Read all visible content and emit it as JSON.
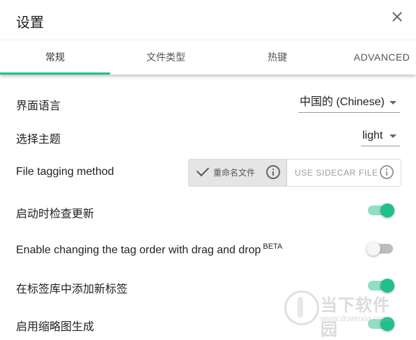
{
  "dialog": {
    "title": "设置"
  },
  "tabs": [
    {
      "label": "常规"
    },
    {
      "label": "文件类型"
    },
    {
      "label": "热键"
    },
    {
      "label": "ADVANCED"
    }
  ],
  "settings": {
    "language": {
      "label": "界面语言",
      "value": "中国的 (Chinese)"
    },
    "theme": {
      "label": "选择主题",
      "value": "light"
    },
    "tagging": {
      "label": "File tagging method",
      "option_rename": "重命名文件",
      "option_sidecar": "USE SIDECAR FILE",
      "selected": "重命名文件"
    },
    "update_check": {
      "label": "启动时检查更新",
      "enabled": true
    },
    "drag_drop": {
      "label": "Enable changing the tag order with drag and drop",
      "badge": "BETA",
      "enabled": false
    },
    "add_to_library": {
      "label": "在标签库中添加新标签",
      "enabled": true
    },
    "thumbnails": {
      "label": "启用缩略图生成",
      "enabled": true
    }
  },
  "watermark": {
    "text": "当下软件园",
    "url": "www.downxia.com"
  },
  "colors": {
    "accent": "#20c08a",
    "toggle_track_on": "#8fe0c3",
    "toggle_track_off": "#bdbdbd"
  }
}
